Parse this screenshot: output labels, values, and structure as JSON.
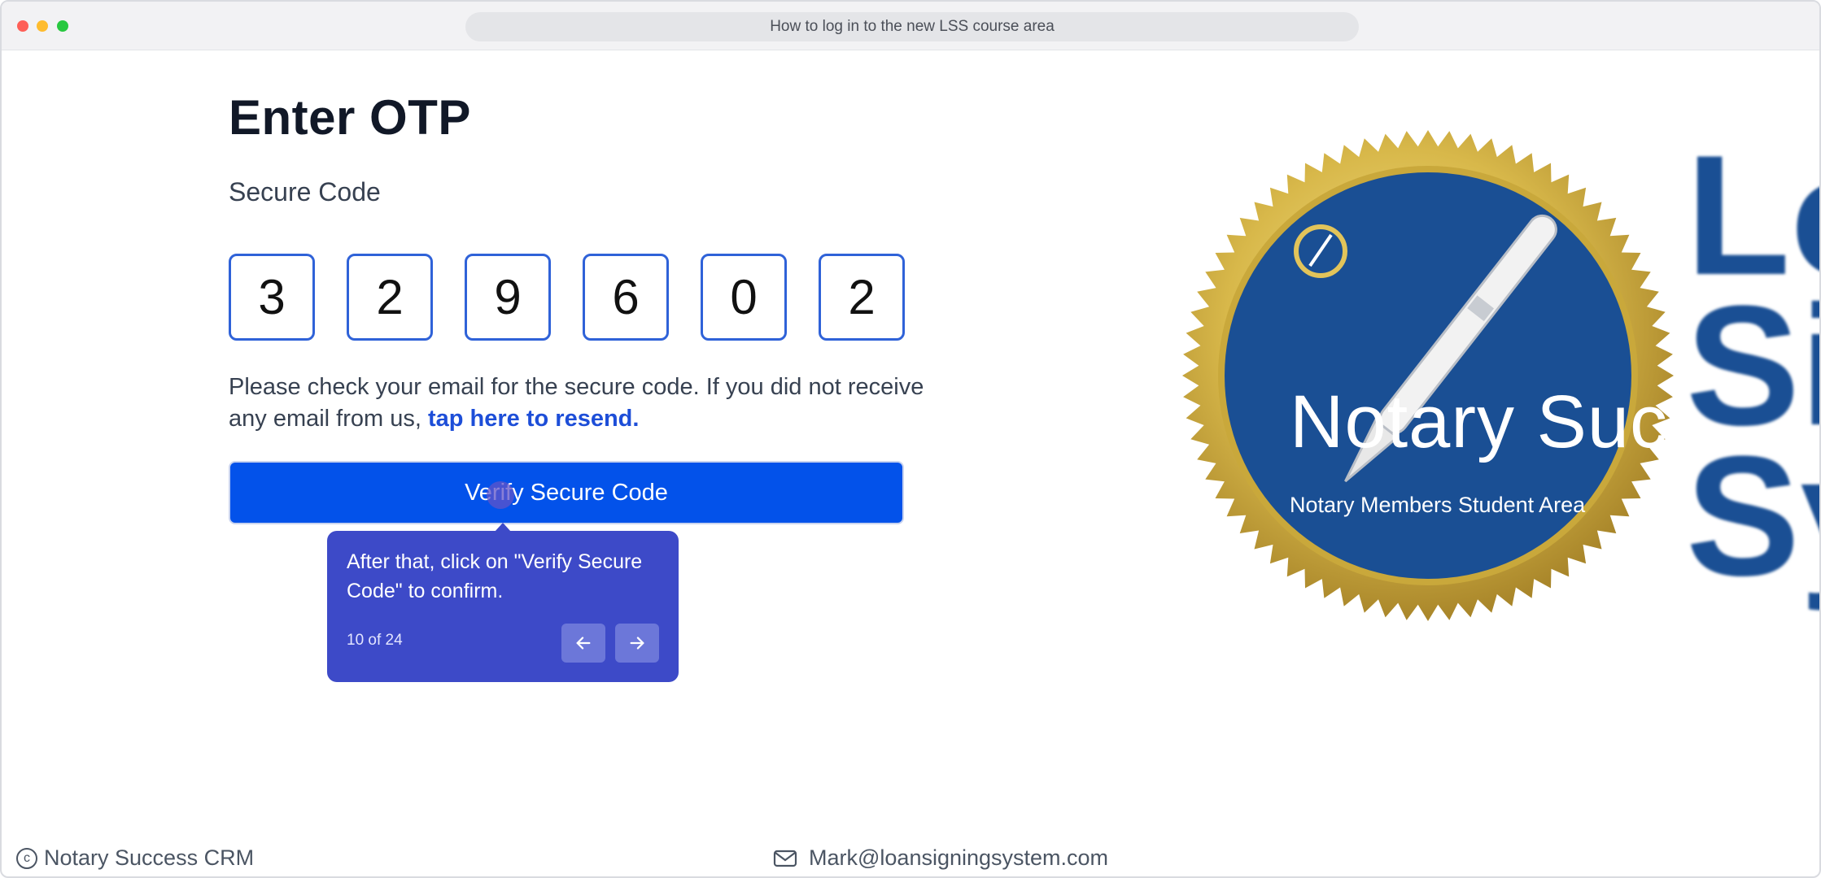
{
  "browser": {
    "tab_title": "How to log in to the new LSS course area"
  },
  "otp_form": {
    "heading": "Enter OTP",
    "subheading": "Secure Code",
    "digits": [
      "3",
      "2",
      "9",
      "6",
      "0",
      "2"
    ],
    "note_text": "Please check your email for the secure code. If you did not receive any email from us, ",
    "resend_link": "tap here to resend.",
    "verify_button": "Verify Secure Code"
  },
  "tooltip": {
    "text": "After that, click on \"Verify Secure Code\" to confirm.",
    "step_counter": "10 of 24",
    "prev_icon": "arrow-left-icon",
    "next_icon": "arrow-right-icon",
    "background_color": "#3d4ac8"
  },
  "branding": {
    "title": "Notary Success",
    "subtitle": "Notary Members Student Area",
    "side_letters": [
      "Lo",
      "Si",
      "Sy"
    ],
    "seal_color": "#1a4f94",
    "seal_rim_color": "#d8b84a"
  },
  "footer": {
    "copyright": "Notary Success CRM",
    "email": "Mark@loansigningsystem.com"
  },
  "colors": {
    "primary_button": "#0352ea",
    "otp_border": "#2f62d8",
    "link": "#1d4ed8"
  }
}
